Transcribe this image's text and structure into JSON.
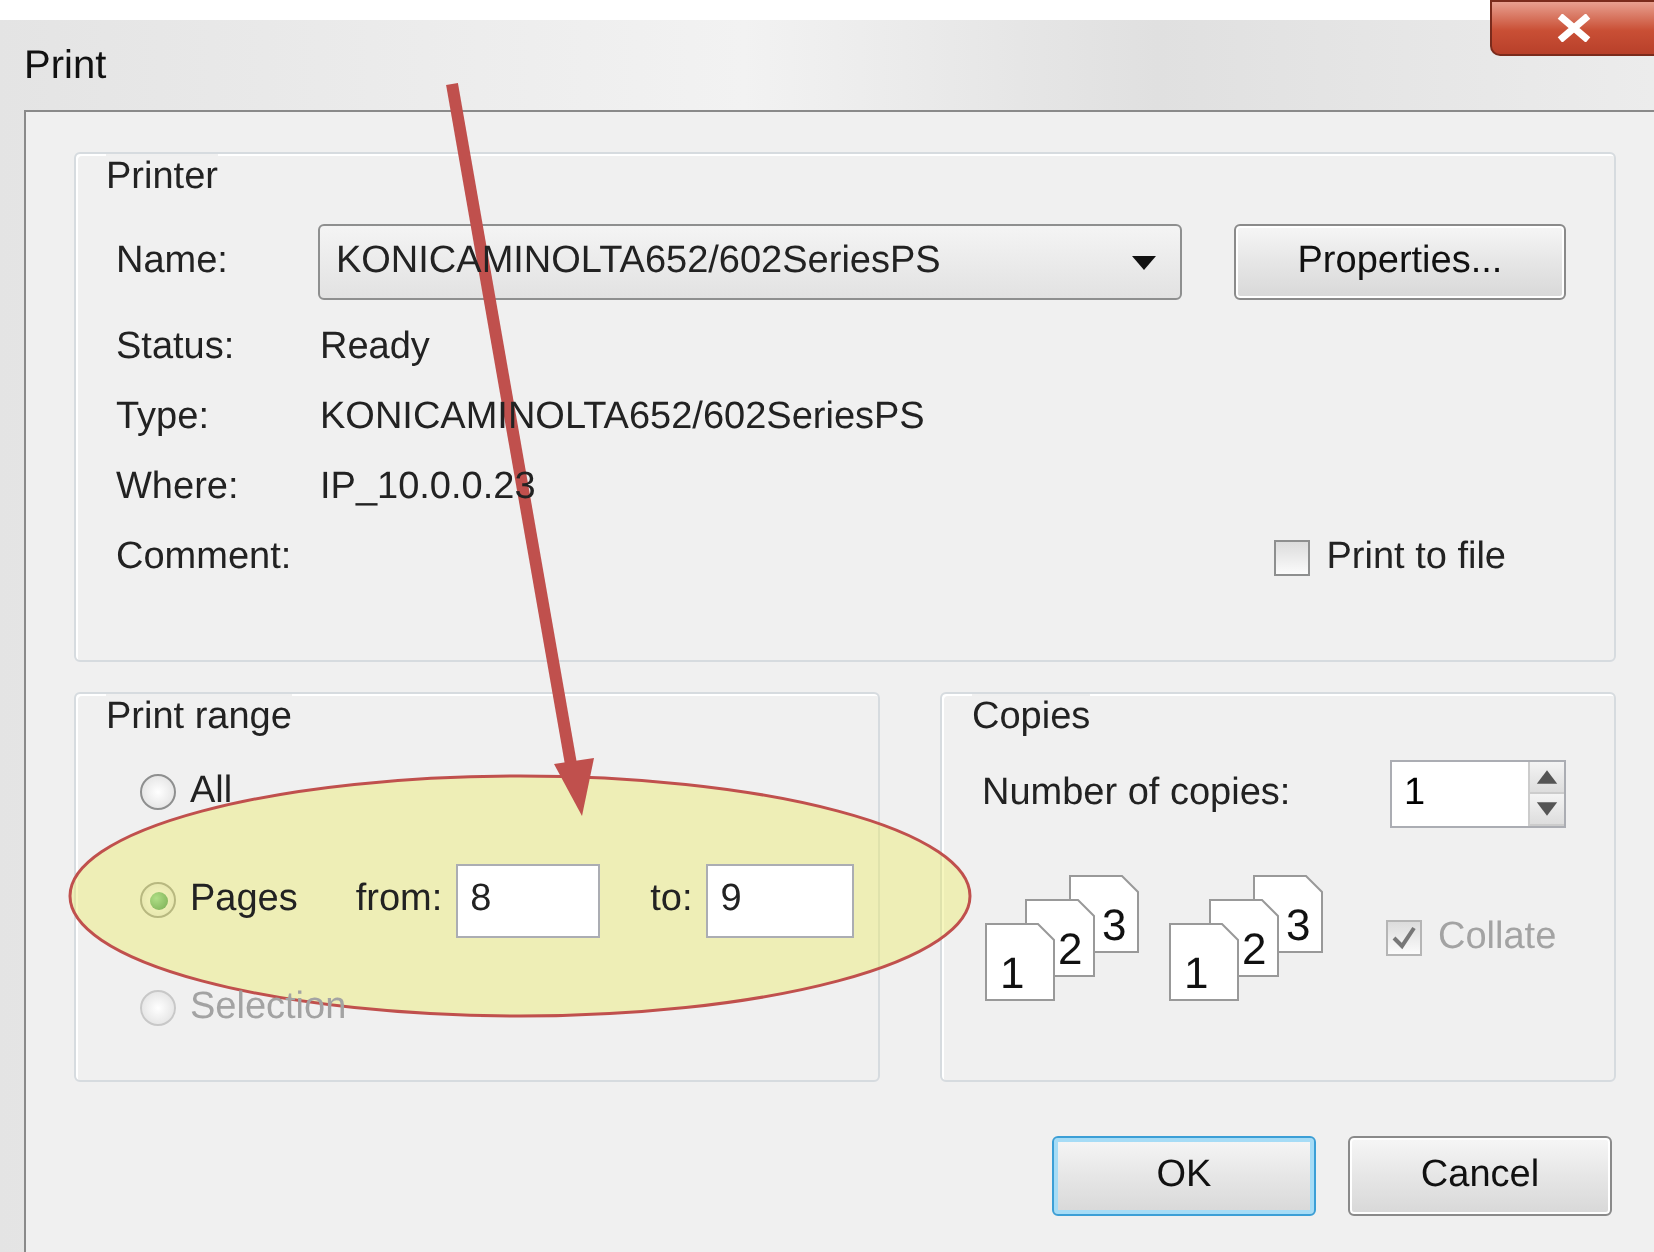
{
  "window": {
    "title": "Print"
  },
  "printer": {
    "title": "Printer",
    "name_label": "Name:",
    "name_value": "KONICAMINOLTA652/602SeriesPS",
    "properties_button": "Properties...",
    "info": [
      {
        "label": "Status:",
        "value": "Ready"
      },
      {
        "label": "Type:",
        "value": "KONICAMINOLTA652/602SeriesPS"
      },
      {
        "label": "Where:",
        "value": "IP_10.0.0.23"
      },
      {
        "label": "Comment:"
      }
    ],
    "print_to_file": {
      "label": "Print to file",
      "checked": false
    }
  },
  "print_range": {
    "title": "Print range",
    "options": [
      {
        "label": "All",
        "selected": false,
        "disabled": false
      },
      {
        "label": "Pages",
        "selected": true,
        "disabled": false
      },
      {
        "label": "Selection",
        "selected": false,
        "disabled": true
      }
    ],
    "from_label": "from:",
    "from_value": "8",
    "to_label": "to:",
    "to_value": "9"
  },
  "copies": {
    "title": "Copies",
    "number_label": "Number of copies:",
    "number_value": "1",
    "stacks": [
      {
        "pages": [
          "1",
          "2",
          "3"
        ]
      },
      {
        "pages": [
          "1",
          "2",
          "3"
        ]
      }
    ],
    "collate": {
      "label": "Collate",
      "checked": true,
      "disabled": true
    }
  },
  "buttons": [
    {
      "label": "OK",
      "default": true
    },
    {
      "label": "Cancel",
      "default": false
    }
  ]
}
